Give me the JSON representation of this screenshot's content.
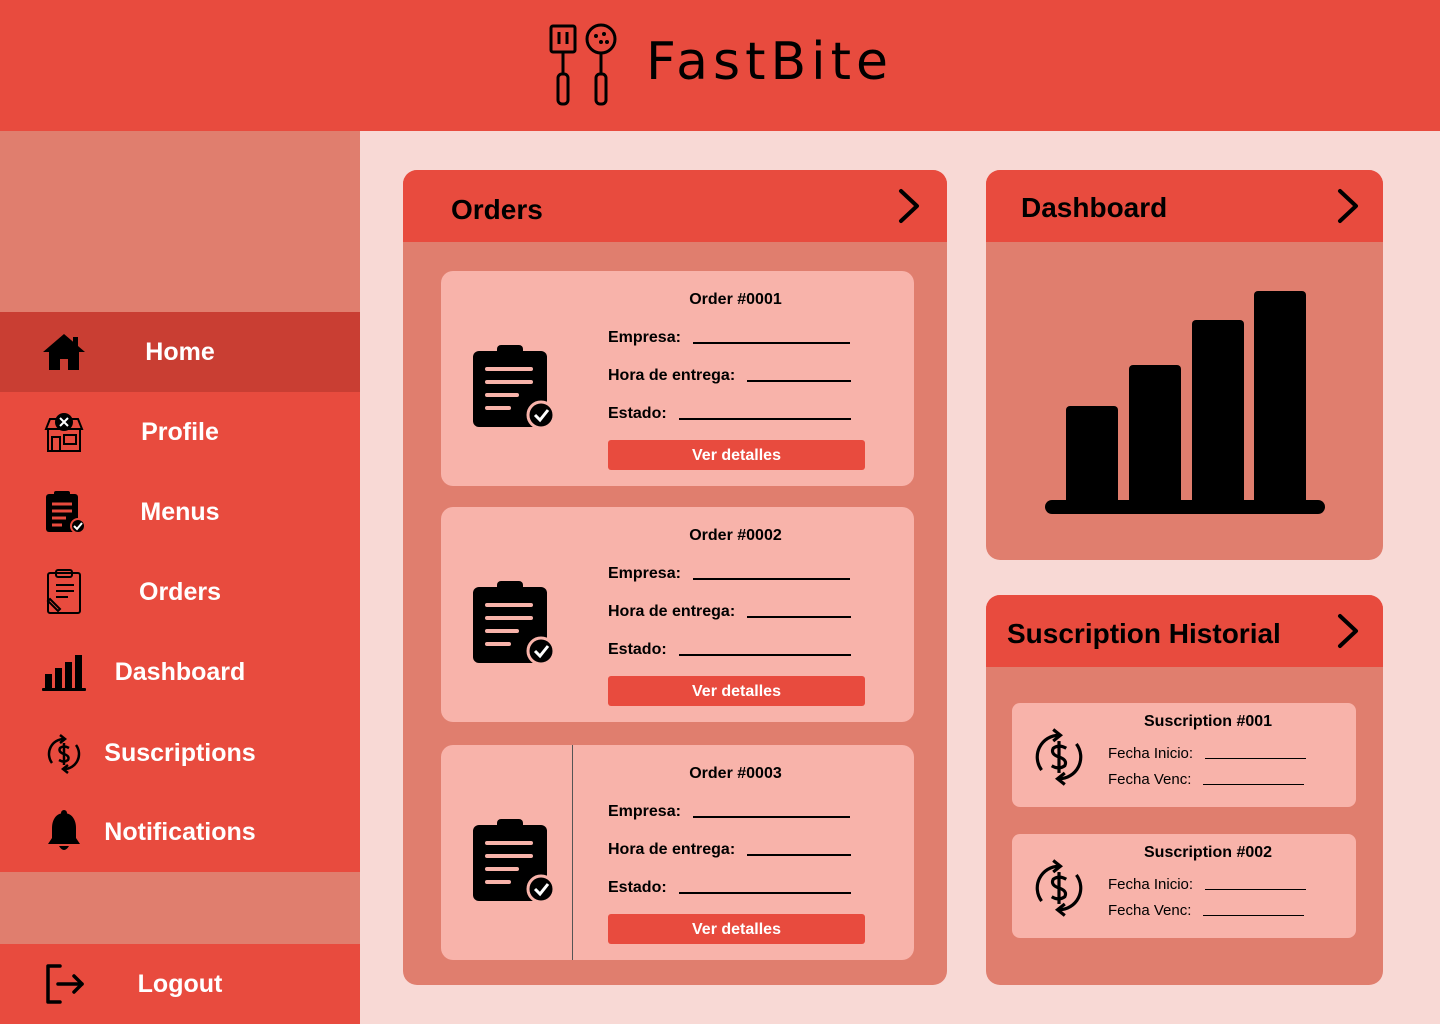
{
  "app": {
    "name": "FastBite"
  },
  "colors": {
    "primary": "#e84b3e",
    "sidebar_bg": "#e07e6e",
    "active": "#c93e33",
    "card": "#f8b3aa",
    "content_bg": "#f8d9d5"
  },
  "sidebar": {
    "items": [
      {
        "label": "Home",
        "icon": "home-icon",
        "active": true
      },
      {
        "label": "Profile",
        "icon": "restaurant-icon"
      },
      {
        "label": "Menus",
        "icon": "menu-clipboard-icon"
      },
      {
        "label": "Orders",
        "icon": "orders-icon"
      },
      {
        "label": "Dashboard",
        "icon": "bar-chart-icon"
      },
      {
        "label": "Suscriptions",
        "icon": "dollar-cycle-icon"
      },
      {
        "label": "Notifications",
        "icon": "bell-icon"
      }
    ],
    "logout": {
      "label": "Logout",
      "icon": "logout-icon"
    }
  },
  "orders": {
    "title": "Orders",
    "fields": {
      "empresa": "Empresa:",
      "hora": "Hora de entrega:",
      "estado": "Estado:"
    },
    "button": "Ver detalles",
    "items": [
      {
        "title": "Order #0001"
      },
      {
        "title": "Order #0002"
      },
      {
        "title": "Order #0003"
      }
    ]
  },
  "dashboard": {
    "title": "Dashboard",
    "icon": "bar-chart-icon"
  },
  "subscriptions": {
    "title": "Suscription Historial",
    "fields": {
      "inicio": "Fecha Inicio:",
      "venc": "Fecha Venc:"
    },
    "items": [
      {
        "title": "Suscription #001"
      },
      {
        "title": "Suscription #002"
      }
    ]
  }
}
